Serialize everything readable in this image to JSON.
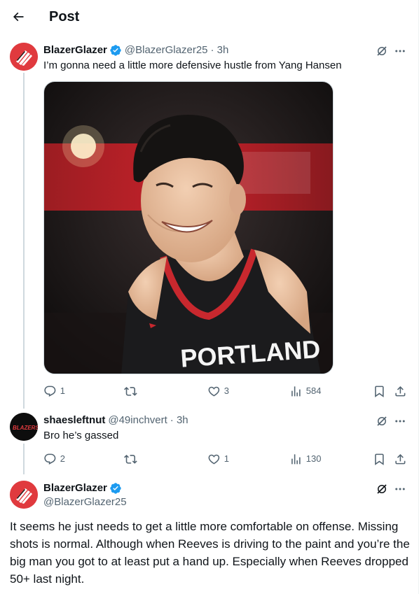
{
  "header": {
    "title": "Post"
  },
  "colors": {
    "accent": "#1d9bf0",
    "blazers_red": "#e03a3e",
    "muted": "#536471"
  },
  "posts": [
    {
      "name": "BlazerGlazer",
      "handle": "@BlazerGlazer25",
      "time": "· 3h",
      "text": "I’m gonna need a little more defensive hustle from Yang Hansen",
      "media": {
        "jersey_text": "PORTLAND"
      },
      "stats": {
        "replies": "1",
        "reposts": "",
        "likes": "3",
        "views": "584"
      }
    },
    {
      "name": "shaesleftnut",
      "handle": "@49inchvert",
      "time": "· 3h",
      "text": "Bro he’s gassed",
      "avatar_text": "BLAZERS",
      "stats": {
        "replies": "2",
        "reposts": "",
        "likes": "1",
        "views": "130"
      }
    },
    {
      "name": "BlazerGlazer",
      "handle": "@BlazerGlazer25",
      "text": "It seems he just needs to get a little more comfortable on offense. Missing shots is normal. Although when Reeves is driving to the paint and you’re the big man you got to at least put a hand up. Especially when Reeves dropped 50+ last night."
    }
  ]
}
